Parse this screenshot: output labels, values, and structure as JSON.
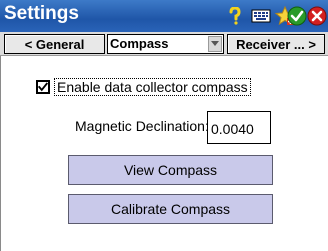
{
  "window": {
    "title": "Settings",
    "title_icons": [
      "help-icon",
      "keyboard-icon",
      "favorites-star-icon",
      "accept-check-icon",
      "close-x-icon"
    ]
  },
  "navigation": {
    "prev_label": "< General",
    "current_page": "Compass",
    "next_label": "Receiver ... >"
  },
  "compass": {
    "enable_label": "Enable data collector compass",
    "enable_checked": true,
    "declination_label": "Magnetic Declination:",
    "declination_value": "0.0040",
    "view_button": "View Compass",
    "calibrate_button": "Calibrate Compass"
  },
  "colors": {
    "titlebar": "#1f56a8",
    "button_fill": "#c9c9ea",
    "accept": "#2a9a2a",
    "close": "#d42020"
  }
}
